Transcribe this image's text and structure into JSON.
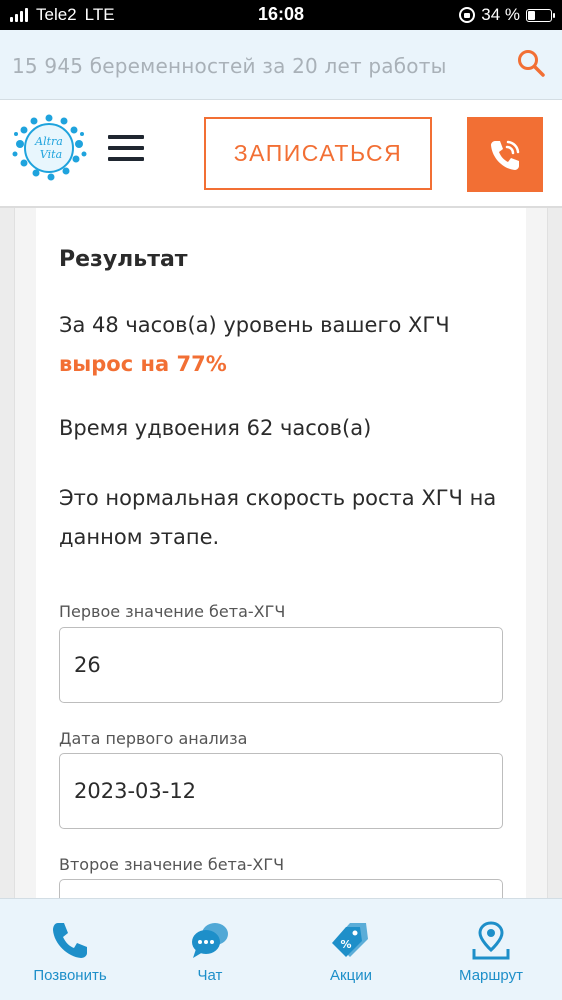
{
  "status_bar": {
    "carrier": "Tele2",
    "network": "LTE",
    "time": "16:08",
    "battery_percent": "34 %",
    "battery_level": 0.34
  },
  "info_bar": {
    "text": "15 945 беременностей за 20 лет работы",
    "icon": "search-icon"
  },
  "header": {
    "logo_text_1": "Altra",
    "logo_text_2": "Vita",
    "signup_label": "ЗАПИСАТЬСЯ",
    "call_icon": "phone-icon",
    "accent_color": "#f26f34"
  },
  "result": {
    "title": "Результат",
    "line1": "За 48 часов(а) уровень вашего ХГЧ",
    "line1_highlight": "вырос на 77%",
    "line2": "Время удвоения 62 часов(а)",
    "line3": "Это нормальная скорость роста ХГЧ на данном этапе."
  },
  "form": {
    "field1_label": "Первое значение бета-ХГЧ",
    "field1_value": "26",
    "field2_label": "Дата первого анализа",
    "field2_value": "2023-03-12",
    "field3_label": "Второе значение бета-ХГЧ",
    "field3_value": ""
  },
  "bottom_nav": {
    "items": [
      {
        "label": "Позвонить",
        "icon": "phone-icon"
      },
      {
        "label": "Чат",
        "icon": "chat-icon"
      },
      {
        "label": "Акции",
        "icon": "tags-icon"
      },
      {
        "label": "Маршрут",
        "icon": "map-route-icon"
      }
    ],
    "color": "#1e8fc9"
  }
}
